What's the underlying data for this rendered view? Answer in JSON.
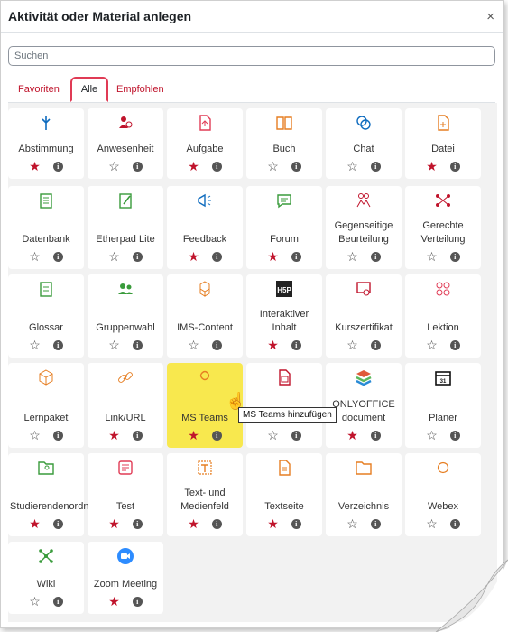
{
  "dialog": {
    "title": "Aktivität oder Material anlegen",
    "close": "×"
  },
  "search": {
    "placeholder": "Suchen"
  },
  "tabs": [
    {
      "label": "Favoriten"
    },
    {
      "label": "Alle"
    },
    {
      "label": "Empfohlen"
    }
  ],
  "colors": {
    "red": "#c0142c",
    "pink": "#e03b55",
    "blue": "#0f6cbf",
    "green": "#399b3b",
    "orange": "#e67e22",
    "highlight": "#f8e84e"
  },
  "modules": [
    {
      "label": "Abstimmung",
      "fav": true,
      "icon": "poll-icon",
      "color": "#0f6cbf"
    },
    {
      "label": "Anwesenheit",
      "fav": false,
      "icon": "attendance-icon",
      "color": "#c0142c"
    },
    {
      "label": "Aufgabe",
      "fav": true,
      "icon": "assignment-icon",
      "color": "#e03b55"
    },
    {
      "label": "Buch",
      "fav": false,
      "icon": "book-icon",
      "color": "#e67e22"
    },
    {
      "label": "Chat",
      "fav": false,
      "icon": "chat-icon",
      "color": "#0f6cbf"
    },
    {
      "label": "Datei",
      "fav": true,
      "icon": "file-icon",
      "color": "#e67e22"
    },
    {
      "label": "Datenbank",
      "fav": false,
      "icon": "database-icon",
      "color": "#399b3b"
    },
    {
      "label": "Etherpad Lite",
      "fav": false,
      "icon": "etherpad-icon",
      "color": "#399b3b"
    },
    {
      "label": "Feedback",
      "fav": true,
      "icon": "feedback-icon",
      "color": "#0f6cbf"
    },
    {
      "label": "Forum",
      "fav": true,
      "icon": "forum-icon",
      "color": "#399b3b"
    },
    {
      "label": "Gegenseitige Beurteilung",
      "fav": false,
      "icon": "workshop-icon",
      "color": "#c0142c"
    },
    {
      "label": "Gerechte Verteilung",
      "fav": false,
      "icon": "ratingallocate-icon",
      "color": "#c0142c"
    },
    {
      "label": "Glossar",
      "fav": false,
      "icon": "glossary-icon",
      "color": "#399b3b"
    },
    {
      "label": "Gruppenwahl",
      "fav": false,
      "icon": "groupselect-icon",
      "color": "#399b3b"
    },
    {
      "label": "IMS-Content",
      "fav": false,
      "icon": "ims-icon",
      "color": "#e67e22"
    },
    {
      "label": "Interaktiver Inhalt",
      "fav": true,
      "icon": "h5p-icon",
      "color": "#111111"
    },
    {
      "label": "Kurszertifikat",
      "fav": false,
      "icon": "certificate-icon",
      "color": "#c0142c"
    },
    {
      "label": "Lektion",
      "fav": false,
      "icon": "lesson-icon",
      "color": "#e03b55"
    },
    {
      "label": "Lernpaket",
      "fav": false,
      "icon": "scorm-icon",
      "color": "#e67e22"
    },
    {
      "label": "Link/URL",
      "fav": true,
      "icon": "link-icon",
      "color": "#e67e22"
    },
    {
      "label": "MS Teams",
      "fav": true,
      "icon": "msteams-icon",
      "color": "#e67e22",
      "highlight": true
    },
    {
      "label": "PDF",
      "fav": false,
      "icon": "pdf-icon",
      "color": "#c0142c"
    },
    {
      "label": "ONLYOFFICE document",
      "fav": true,
      "icon": "onlyoffice-icon",
      "color": "#2aa35b"
    },
    {
      "label": "Planer",
      "fav": false,
      "icon": "calendar-icon",
      "color": "#111111"
    },
    {
      "label": "Studierendenordner",
      "fav": true,
      "icon": "folder-user-icon",
      "color": "#399b3b"
    },
    {
      "label": "Test",
      "fav": true,
      "icon": "quiz-icon",
      "color": "#e03b55"
    },
    {
      "label": "Text- und Medienfeld",
      "fav": true,
      "icon": "textfield-icon",
      "color": "#e67e22"
    },
    {
      "label": "Textseite",
      "fav": true,
      "icon": "page-icon",
      "color": "#e67e22"
    },
    {
      "label": "Verzeichnis",
      "fav": false,
      "icon": "folder-icon",
      "color": "#e67e22"
    },
    {
      "label": "Webex",
      "fav": false,
      "icon": "webex-icon",
      "color": "#e67e22"
    },
    {
      "label": "Wiki",
      "fav": false,
      "icon": "wiki-icon",
      "color": "#399b3b"
    },
    {
      "label": "Zoom Meeting",
      "fav": true,
      "icon": "zoom-icon",
      "color": "#2d8cff"
    }
  ],
  "tooltip": "MS Teams hinzufügen"
}
